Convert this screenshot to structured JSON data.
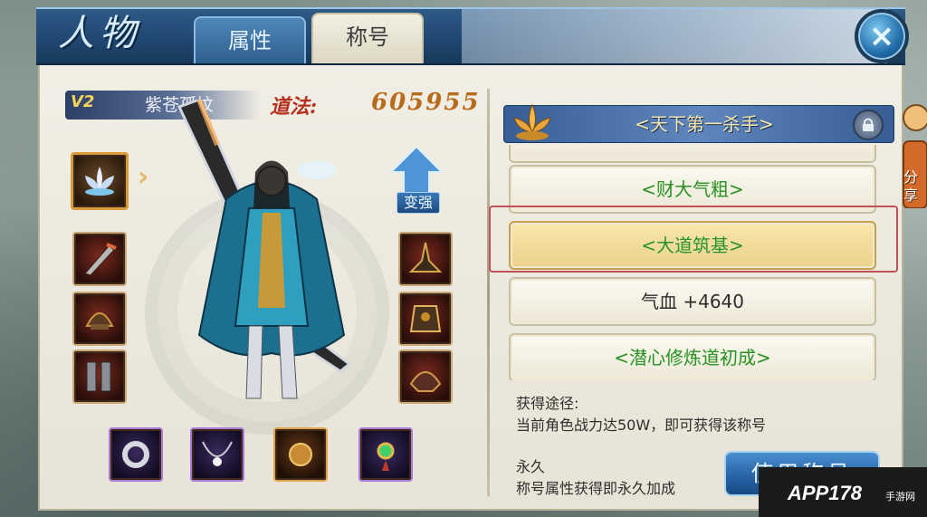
{
  "header": {
    "page_title": "人物",
    "tabs": [
      {
        "label": "属性",
        "active": false
      },
      {
        "label": "称号",
        "active": true
      }
    ]
  },
  "character": {
    "vip_level": "V2",
    "name": "紫苍孤坟",
    "daofa_label": "道法:",
    "daofa_value": "605955",
    "upgrade_label": "变强"
  },
  "equipment": {
    "left_slots": [
      "weapon-icon",
      "helmet-icon",
      "boots-icon"
    ],
    "right_slots": [
      "hat-icon",
      "armor-icon",
      "shoulder-icon"
    ],
    "bottom_slots": [
      "ring-icon",
      "necklace-icon",
      "amulet-icon",
      "pendant-icon"
    ]
  },
  "titles": {
    "current": "<天下第一杀手>",
    "list": [
      {
        "label": "",
        "color": "green",
        "selected": false
      },
      {
        "label": "<财大气粗>",
        "color": "green",
        "selected": false
      },
      {
        "label": "<大道筑基>",
        "color": "green",
        "selected": true
      },
      {
        "label": "气血 +4640",
        "color": "plain",
        "selected": false
      },
      {
        "label": "<潜心修炼道初成>",
        "color": "green",
        "selected": false
      }
    ]
  },
  "info": {
    "source_label": "获得途径:",
    "source_text": "当前角色战力达50W，即可获得该称号",
    "duration_label": "永久",
    "duration_text": "称号属性获得即永久加成"
  },
  "actions": {
    "use_title": "使用称号",
    "share": "分享",
    "close": "×"
  },
  "watermark": {
    "text": "APP178",
    "sub": "手游网"
  },
  "colors": {
    "accent_blue": "#2d5a86",
    "title_green": "#2f8f2a",
    "daofa_red": "#b5301e",
    "daofa_gold": "#b86b1c",
    "panel_bg": "#f1eee5"
  }
}
